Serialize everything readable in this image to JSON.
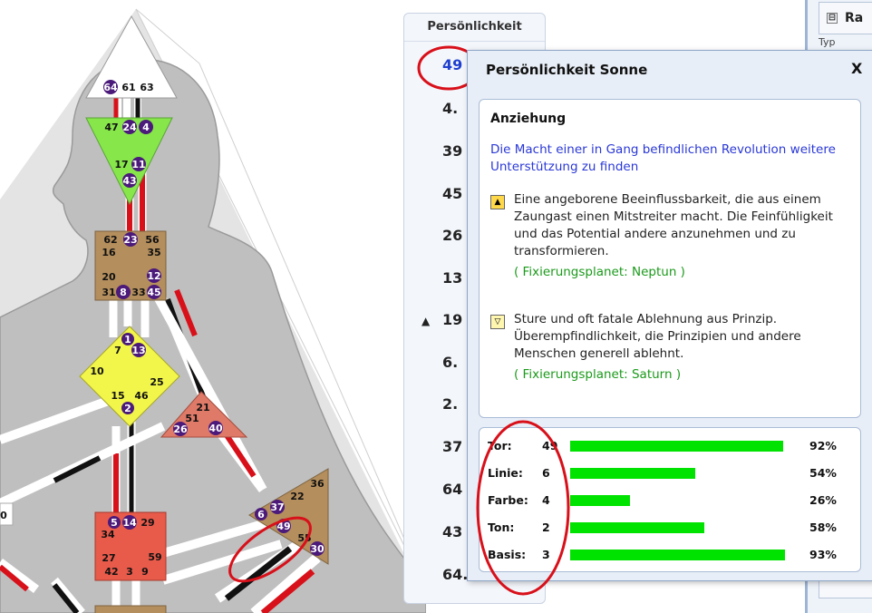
{
  "chart_gates": {
    "head": [
      "64",
      "61",
      "63"
    ],
    "ajna": [
      "47",
      "24",
      "4",
      "17",
      "11",
      "43"
    ],
    "throat": [
      "62",
      "23",
      "56",
      "16",
      "35",
      "20",
      "12",
      "31",
      "8",
      "33",
      "45"
    ],
    "g_center": [
      "1",
      "7",
      "13",
      "10",
      "25",
      "15",
      "46",
      "2"
    ],
    "heart": [
      "21",
      "51",
      "26",
      "40"
    ],
    "spleen_left": [
      "0"
    ],
    "sacral": [
      "5",
      "14",
      "29",
      "34",
      "27",
      "59",
      "42",
      "3",
      "9"
    ],
    "solar_plexus": [
      "36",
      "22",
      "6",
      "37",
      "49",
      "55",
      "30"
    ]
  },
  "side_column": {
    "header": "Persönlichkeit",
    "numbers": [
      "49",
      "4.",
      "39",
      "45",
      "26",
      "13",
      "19",
      "6.",
      "2.",
      "37",
      "64",
      "43",
      "64."
    ],
    "marker": "▲"
  },
  "right_panel": {
    "tab_label": "Ra",
    "tab_minus": "⊟",
    "sub_label": "Typ"
  },
  "popup": {
    "title": "Persönlichkeit Sonne",
    "close_label": "X",
    "heading": "Anziehung",
    "description": "Die Macht einer in Gang befindlichen Revolution weitere Unterstützung zu finden",
    "exalted_symbol": "▲",
    "exalted_text": "Eine angeborene Beeinflussbarkeit, die aus einem Zaungast einen Mitstreiter macht. Die Feinfühligkeit und das Potential andere anzunehmen und zu transformieren.",
    "exalted_planet": "( Fixierungsplanet: Neptun )",
    "detriment_symbol": "▽",
    "detriment_text": "Sture und oft fatale Ablehnung aus Prinzip. Überempfindlichkeit, die Prinzipien und andere Menschen generell ablehnt.",
    "detriment_planet": "( Fixierungsplanet: Saturn )",
    "stats": [
      {
        "label": "Tor:",
        "value": "49",
        "percent": 92,
        "percent_label": "92%"
      },
      {
        "label": "Linie:",
        "value": "6",
        "percent": 54,
        "percent_label": "54%"
      },
      {
        "label": "Farbe:",
        "value": "4",
        "percent": 26,
        "percent_label": "26%"
      },
      {
        "label": "Ton:",
        "value": "2",
        "percent": 58,
        "percent_label": "58%"
      },
      {
        "label": "Basis:",
        "value": "3",
        "percent": 93,
        "percent_label": "93%"
      }
    ]
  },
  "colors": {
    "bar_green": "#00e200",
    "annotation_red": "#d8101a",
    "gate_purple": "#4b1a7a",
    "title_blue": "#2a38d6"
  }
}
